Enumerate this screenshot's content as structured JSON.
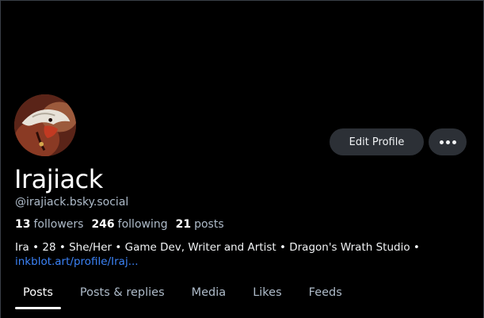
{
  "profile": {
    "display_name": "Irajiack",
    "handle": "@irajiack.bsky.social",
    "avatar_icon": "dragon-avatar-icon"
  },
  "actions": {
    "edit_label": "Edit Profile",
    "more_icon": "more-horizontal-icon"
  },
  "stats": {
    "followers_count": "13",
    "followers_label": "followers",
    "following_count": "246",
    "following_label": "following",
    "posts_count": "21",
    "posts_label": "posts"
  },
  "bio": {
    "text": "Ira • 28 • She/Her • Game Dev, Writer and Artist • Dragon's Wrath Studio •",
    "link": "inkblot.art/profile/Iraj..."
  },
  "tabs": [
    {
      "label": "Posts",
      "active": true
    },
    {
      "label": "Posts & replies",
      "active": false
    },
    {
      "label": "Media",
      "active": false
    },
    {
      "label": "Likes",
      "active": false
    },
    {
      "label": "Feeds",
      "active": false
    }
  ],
  "colors": {
    "background": "#000000",
    "button_bg": "#2c3036",
    "muted_text": "#aebbc9",
    "link": "#3b82f6"
  }
}
